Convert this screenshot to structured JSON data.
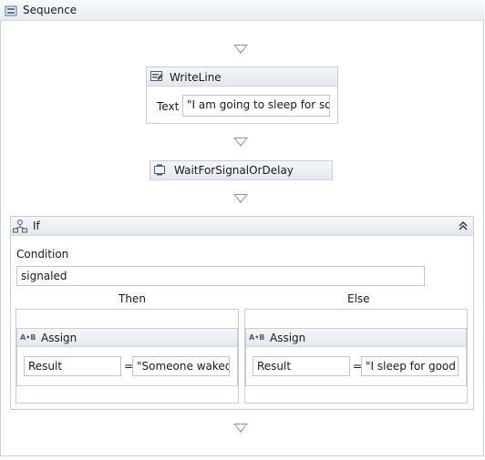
{
  "sequence": {
    "title": "Sequence"
  },
  "writeline": {
    "title": "WriteLine",
    "text_label": "Text",
    "text_value": "\"I am going to sleep for some"
  },
  "wait": {
    "title": "WaitForSignalOrDelay"
  },
  "if": {
    "title": "If",
    "condition_label": "Condition",
    "condition_value": "signaled",
    "then_label": "Then",
    "else_label": "Else",
    "then_assign": {
      "title": "Assign",
      "to": "Result",
      "op": "=",
      "value": "\"Someone waked n"
    },
    "else_assign": {
      "title": "Assign",
      "to": "Result",
      "op": "=",
      "value": "\"I sleep for good du"
    }
  }
}
